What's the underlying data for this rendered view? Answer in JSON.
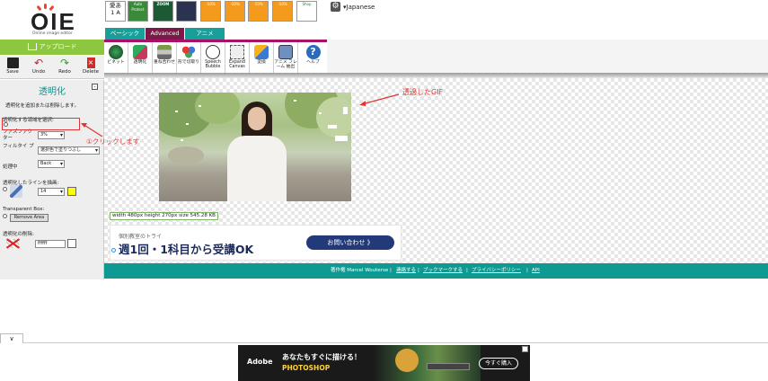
{
  "app": {
    "logo_text": "OIE",
    "logo_subtitle": "Online image editor",
    "language": "▾Japanese"
  },
  "header": {
    "upload_label": "アップロード",
    "ads": [
      {
        "name": "ad-thumb-kanji",
        "text": "愛あ\n1 A"
      },
      {
        "name": "ad-thumb-green",
        "text": "Auto Protect"
      },
      {
        "name": "ad-thumb-zoom",
        "text": "ZOOM"
      },
      {
        "name": "ad-thumb-dark",
        "text": ""
      },
      {
        "name": "ad-thumb-orange-1",
        "text": "-10%"
      },
      {
        "name": "ad-thumb-orange-2",
        "text": "-10%"
      },
      {
        "name": "ad-thumb-orange-3",
        "text": "-10%"
      },
      {
        "name": "ad-thumb-orange-4",
        "text": "-10%"
      },
      {
        "name": "ad-thumb-shop",
        "text": "Shop"
      }
    ]
  },
  "tabs": [
    {
      "label": "ベーシック"
    },
    {
      "label": "Advanced"
    },
    {
      "label": "アニメ"
    }
  ],
  "toolbar": [
    {
      "label": "ビネット",
      "icon": "vignette-icon",
      "color": "#1b6d2f"
    },
    {
      "label": "透明化",
      "icon": "transparency-icon",
      "color": "#2eaa5a"
    },
    {
      "label": "重ね合わせ",
      "icon": "layers-icon",
      "color": "#7c9a4c"
    },
    {
      "label": "形で切取り",
      "icon": "heart-crop-icon",
      "color": "#d44"
    },
    {
      "label": "Speech Bubble",
      "icon": "speech-bubble-icon",
      "color": "#ffffff"
    },
    {
      "label": "Expand Canvas",
      "icon": "expand-canvas-icon",
      "color": "#eeeeee"
    },
    {
      "label": "変換",
      "icon": "convert-icon",
      "color": "#f5b21c"
    },
    {
      "label": "アニメ フレーム 抽出",
      "icon": "frame-extract-icon",
      "color": "#6f8fbf"
    },
    {
      "label": "ヘルプ",
      "icon": "help-icon",
      "color": "#2a6bbd"
    }
  ],
  "left_tools": [
    {
      "label": "Save",
      "icon": "save-icon"
    },
    {
      "label": "Undo",
      "icon": "undo-icon"
    },
    {
      "label": "Redo",
      "icon": "redo-icon"
    },
    {
      "label": "Delete",
      "icon": "delete-icon"
    }
  ],
  "panel": {
    "title": "透明化",
    "minimize": "-",
    "intro": "透明化を追加または削除します。",
    "area_select_label": "透明化する領域を選択:",
    "fuzz_label": "ファズファク ター",
    "fuzz_value": "3%",
    "fill_type_label": "フィルタイ プ",
    "fill_type_value": "選択色で塗りつぶし",
    "processing_label": "処理中",
    "processing_value": "Back",
    "line_label": "透明化したラインを描画:",
    "line_value": "14",
    "transparent_box_label": "Transparent Box:",
    "remove_area_label": "Remove Area",
    "remove_label": "透明化の削除:",
    "remove_color_value": "ffffff"
  },
  "canvas": {
    "size_info": "width 480px height 270px size 545.28 KB"
  },
  "ad_mid": {
    "small_text": "個別教室のトライ",
    "big_text": "週1回・1科目から受講OK",
    "button": "お問い合わせ 》"
  },
  "footer": {
    "credit": "著作権 Marcel Wouterse |",
    "links": [
      "連絡する",
      "ブックマークする",
      "プライバシーポリシー",
      "API"
    ]
  },
  "annotations": {
    "click_note": "①クリックします",
    "gif_note": "透過したGIF",
    "color": "#e23434"
  },
  "ad_bottom": {
    "brand": "Adobe",
    "line1": "あなたもすぐに描ける！",
    "line2": "PHOTOSHOP",
    "button": "今すぐ購入"
  },
  "bottom_bar": {
    "chevron": "∨"
  }
}
